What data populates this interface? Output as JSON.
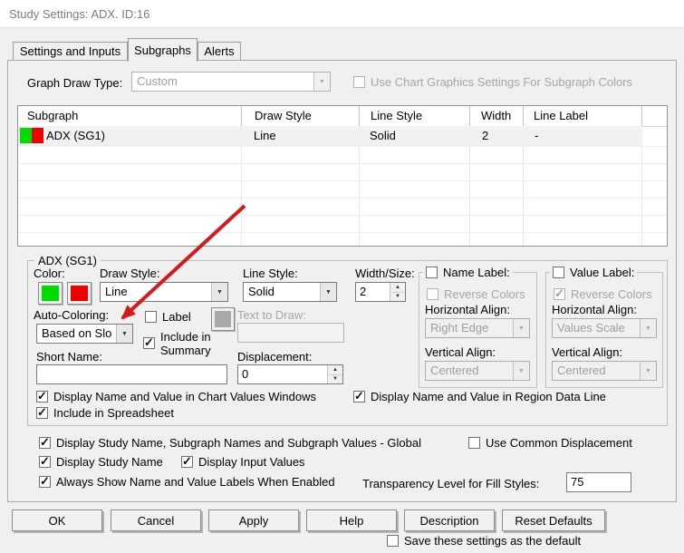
{
  "window": {
    "title": "Study Settings: ADX. ID:16"
  },
  "tabs": [
    {
      "label": "Settings and Inputs",
      "active": false
    },
    {
      "label": "Subgraphs",
      "active": true
    },
    {
      "label": "Alerts",
      "active": false
    }
  ],
  "graph_draw_type": {
    "label": "Graph Draw Type:",
    "value": "Custom",
    "use_chart_checkbox_label": "Use Chart Graphics Settings For Subgraph Colors",
    "use_chart_checked": false
  },
  "subgraph_table": {
    "columns": [
      "Subgraph",
      "Draw Style",
      "Line Style",
      "Width",
      "Line Label"
    ],
    "row": {
      "name": "ADX (SG1)",
      "draw_style": "Line",
      "line_style": "Solid",
      "width": "2",
      "line_label": "-",
      "swatch_color_1": "#00dc00",
      "swatch_color_2": "#ee0000",
      "selected": true
    }
  },
  "sg_group": {
    "title": "ADX (SG1)",
    "color_label": "Color:",
    "color1": "#00dc00",
    "color2": "#ee0000",
    "draw_style_label": "Draw Style:",
    "draw_style_value": "Line",
    "line_style_label": "Line Style:",
    "line_style_value": "Solid",
    "width_size_label": "Width/Size:",
    "width_size_value": "2",
    "auto_coloring_label": "Auto-Coloring:",
    "auto_coloring_value": "Based on Slo",
    "label_checkbox": "Label",
    "label_checked": false,
    "label_color_swatch": "#a8a8a8",
    "include_summary_line1": "Include in",
    "include_summary_line2": "Summary",
    "include_summary_checked": true,
    "text_to_draw_label": "Text to Draw:",
    "text_to_draw_value": "",
    "short_name_label": "Short Name:",
    "short_name_value": "",
    "displacement_label": "Displacement:",
    "displacement_value": "0",
    "name_label": {
      "title": "Name Label:",
      "checked": false,
      "reverse_colors": "Reverse Colors",
      "reverse_colors_checked": false,
      "horizontal_align_label": "Horizontal Align:",
      "horizontal_align_value": "Right Edge",
      "vertical_align_label": "Vertical Align:",
      "vertical_align_value": "Centered"
    },
    "value_label": {
      "title": "Value Label:",
      "checked": false,
      "reverse_colors": "Reverse Colors",
      "reverse_colors_checked": true,
      "horizontal_align_label": "Horizontal Align:",
      "horizontal_align_value": "Values Scale",
      "vertical_align_label": "Vertical Align:",
      "vertical_align_value": "Centered"
    },
    "cb_chart_values": "Display Name and Value in Chart Values Windows",
    "cb_chart_values_checked": true,
    "cb_region_data": "Display Name and Value in Region Data Line",
    "cb_region_data_checked": true,
    "cb_spreadsheet": "Include in Spreadsheet",
    "cb_spreadsheet_checked": true
  },
  "global_options": {
    "cb_global": "Display Study Name, Subgraph Names and Subgraph Values - Global",
    "cb_global_checked": true,
    "cb_common_displacement": "Use Common Displacement",
    "cb_common_displacement_checked": false,
    "cb_study_name": "Display Study Name",
    "cb_study_name_checked": true,
    "cb_input_values": "Display Input Values",
    "cb_input_values_checked": true,
    "cb_always_show": "Always Show Name and Value Labels When Enabled",
    "cb_always_show_checked": true,
    "transparency_label": "Transparency Level for Fill Styles:",
    "transparency_value": "75"
  },
  "buttons": {
    "ok": "OK",
    "cancel": "Cancel",
    "apply": "Apply",
    "help": "Help",
    "description": "Description",
    "reset_defaults": "Reset Defaults"
  },
  "save_default": {
    "label": "Save these settings as the default",
    "checked": false
  },
  "annotation": {
    "arrow_color": "#d41a1a"
  }
}
